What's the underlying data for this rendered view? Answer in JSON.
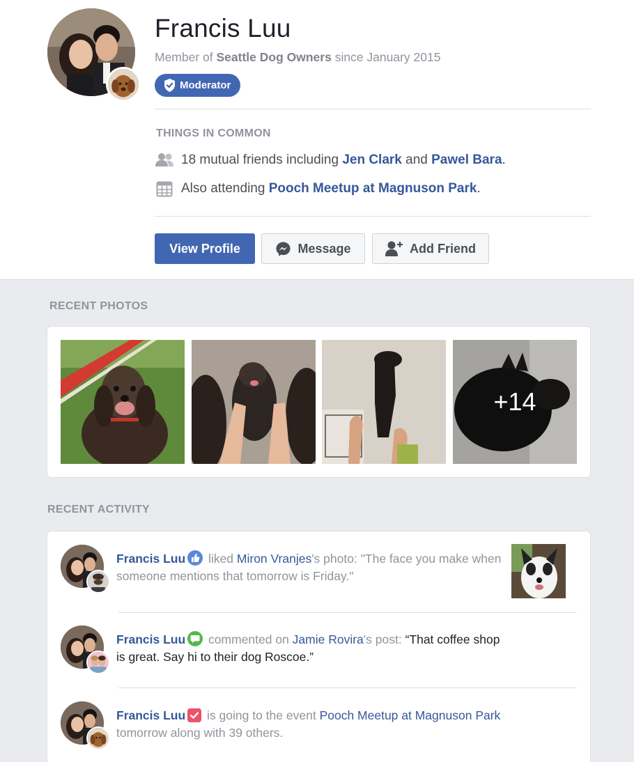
{
  "profile": {
    "name": "Francis Luu",
    "member_prefix": "Member of ",
    "group_name": "Seattle Dog Owners",
    "member_suffix": " since January 2015",
    "badge": "Moderator"
  },
  "common": {
    "heading": "THINGS IN COMMON",
    "friends_prefix": "18 mutual friends including ",
    "friend_1": "Jen Clark",
    "friends_and": " and ",
    "friend_2": "Pawel Bara",
    "friends_end": ".",
    "event_prefix": "Also attending ",
    "event_name": "Pooch Meetup at Magnuson Park",
    "event_end": "."
  },
  "actions": {
    "view_profile": "View Profile",
    "message": "Message",
    "add_friend": "Add Friend"
  },
  "photos": {
    "heading": "RECENT PHOTOS",
    "more_count": "+14"
  },
  "activity": {
    "heading": "RECENT ACTIVITY",
    "items": [
      {
        "name": "Francis Luu",
        "verb": " liked ",
        "target": "Miron Vranjes",
        "rest": "'s photo: \"The face you make when someone mentions that tomorrow is Friday.\""
      },
      {
        "name": "Francis Luu",
        "verb": " commented on ",
        "target": "Jamie Rovira",
        "rest": "'s post: ",
        "quote": "“That coffee shop is great. Say hi to their dog Roscoe.”"
      },
      {
        "name": "Francis Luu",
        "verb": " is going to the event ",
        "target": "Pooch Meetup at Magnuson Park",
        "rest": " tomorrow along with 39 others."
      }
    ]
  },
  "colors": {
    "accent": "#4267b2",
    "link": "#365899",
    "like_icon": "#5b87d8",
    "comment_icon": "#54b948",
    "event_icon": "#f05068"
  },
  "icons": {
    "badge": "shield-check-icon",
    "friends": "people-icon",
    "event": "calendar-icon",
    "message": "messenger-icon",
    "add_friend": "add-person-icon",
    "like": "thumbs-up-icon",
    "comment": "comment-bubble-icon",
    "going": "check-square-icon"
  }
}
